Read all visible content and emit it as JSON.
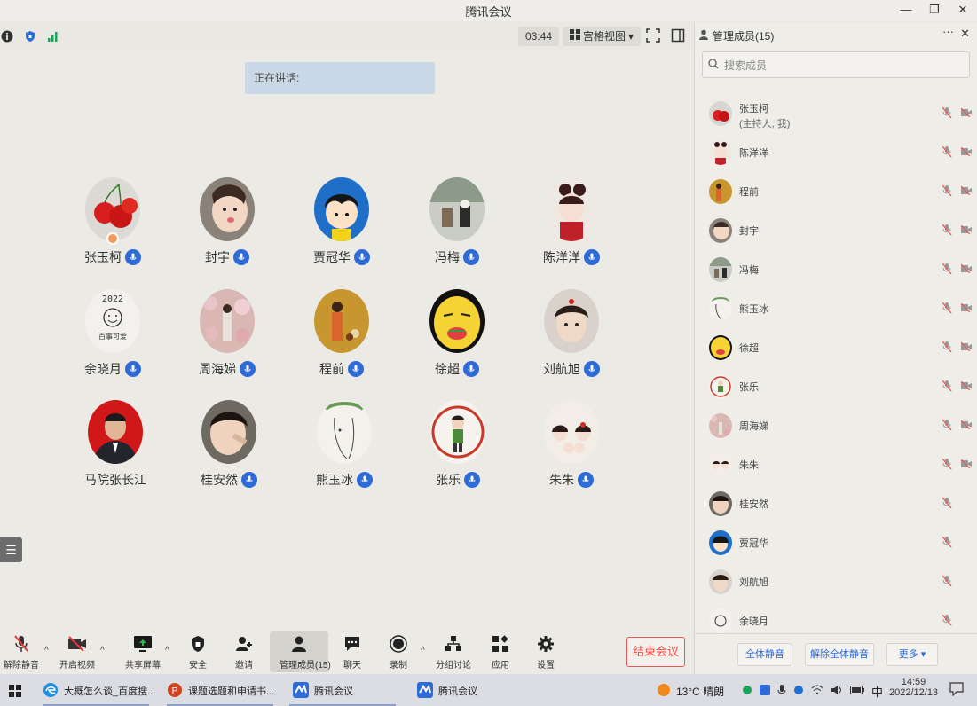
{
  "window": {
    "title": "腾讯会议",
    "min": "—",
    "restore": "❐",
    "close": "✕"
  },
  "topbar": {
    "timer": "03:44",
    "view_label": "宫格视图",
    "view_caret": "▾"
  },
  "speaking": "正在讲话:",
  "participants": [
    {
      "name": "张玉柯"
    },
    {
      "name": "封宇"
    },
    {
      "name": "贾冠华"
    },
    {
      "name": "冯梅"
    },
    {
      "name": "陈洋洋"
    },
    {
      "name": "余晓月"
    },
    {
      "name": "周海娣"
    },
    {
      "name": "程前"
    },
    {
      "name": "徐超"
    },
    {
      "name": "刘航旭"
    },
    {
      "name": "马院张长江"
    },
    {
      "name": "桂安然"
    },
    {
      "name": "熊玉冰"
    },
    {
      "name": "张乐"
    },
    {
      "name": "朱朱"
    }
  ],
  "avatar_text": {
    "top": "2022",
    "bottom": "百事可爱"
  },
  "toolbar": {
    "unmute": "解除静音",
    "video": "开启视频",
    "share": "共享屏幕",
    "security": "安全",
    "invite": "邀请",
    "members": "管理成员(15)",
    "chat": "聊天",
    "record": "录制",
    "breakout": "分组讨论",
    "apps": "应用",
    "settings": "设置",
    "end": "结束会议",
    "caret": "^"
  },
  "panel": {
    "title": "管理成员(15)",
    "more": "···",
    "close": "✕",
    "search_placeholder": "搜索成员",
    "members": [
      {
        "name": "张玉柯",
        "sub": "(主持人, 我)"
      },
      {
        "name": "陈洋洋"
      },
      {
        "name": "程前"
      },
      {
        "name": "封宇"
      },
      {
        "name": "冯梅"
      },
      {
        "name": "熊玉冰"
      },
      {
        "name": "徐超"
      },
      {
        "name": "张乐"
      },
      {
        "name": "周海娣"
      },
      {
        "name": "朱朱"
      },
      {
        "name": "桂安然"
      },
      {
        "name": "贾冠华"
      },
      {
        "name": "刘航旭"
      },
      {
        "name": "余晓月"
      }
    ],
    "btn_mute_all": "全体静音",
    "btn_unmute_all": "解除全体静音",
    "btn_more": "更多"
  },
  "taskbar": {
    "app1": "大概怎么谈_百度搜...",
    "app2": "课题选题和申请书...",
    "app3": "腾讯会议",
    "app4": "腾讯会议",
    "weather": "13°C 晴朗",
    "ime": "中",
    "time": "14:59",
    "date": "2022/12/13"
  }
}
